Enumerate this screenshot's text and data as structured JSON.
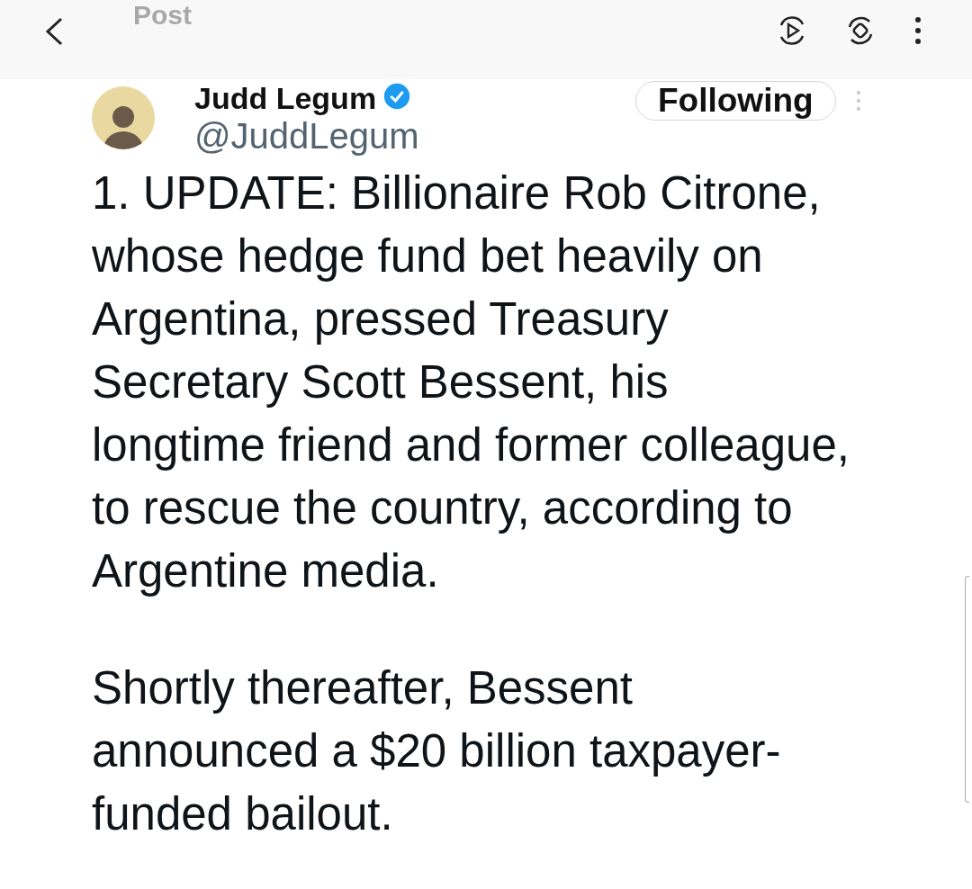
{
  "top_bar": {
    "title": "Post"
  },
  "tweet": {
    "name": "Judd Legum",
    "verified": true,
    "handle": "@JuddLegum",
    "follow_button": "Following",
    "paragraphs": [
      "1. UPDATE: Billionaire Rob Citrone, whose hedge fund bet heavily on Argentina, pressed Treasury Secretary Scott Bessent, his longtime friend and former colleague, to rescue the country, according to Argentine media.",
      "Shortly thereafter, Bessent announced a $20 billion taxpayer-funded bailout."
    ]
  }
}
